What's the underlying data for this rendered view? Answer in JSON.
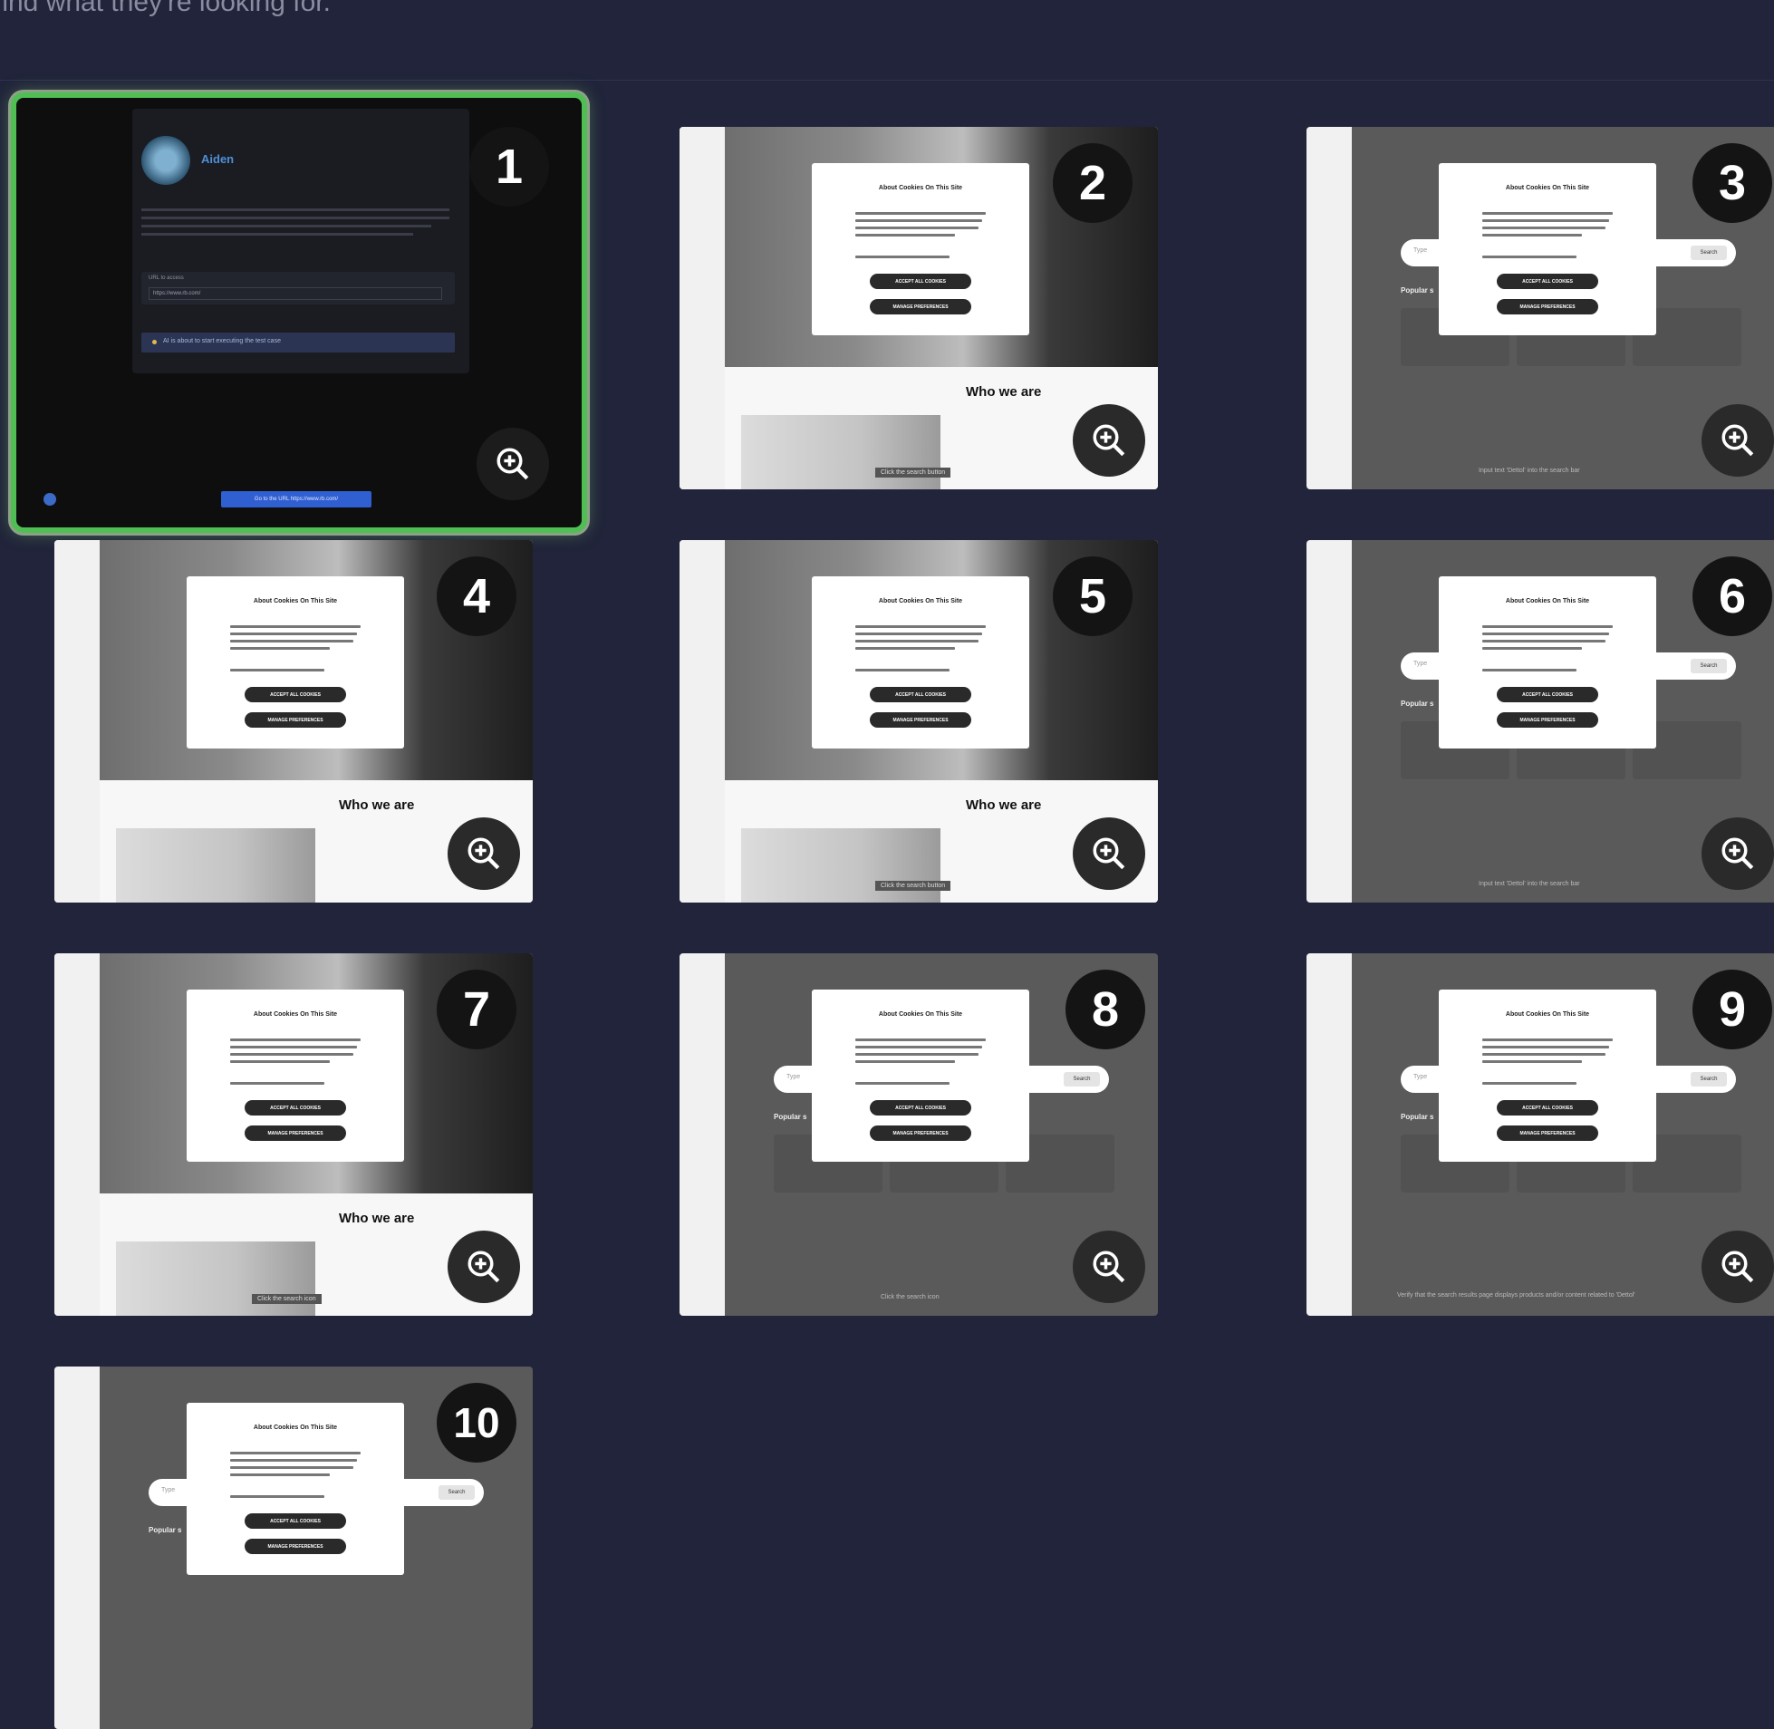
{
  "header": {
    "caption": "find what they're looking for."
  },
  "thumbnails": [
    {
      "number": "1",
      "selected": true,
      "kind": "agent",
      "agent_name": "Aiden",
      "url_label": "URL to access",
      "url_value": "https://www.rb.com/",
      "status_text": "AI is about to start executing the test case",
      "action_text": "Go to the URL https://www.rb.com/"
    },
    {
      "number": "2",
      "kind": "hero",
      "who_title": "Who we are",
      "caption": "Click the search button"
    },
    {
      "number": "3",
      "kind": "search",
      "caption": "Input text 'Dettol' into the search bar"
    },
    {
      "number": "4",
      "kind": "hero",
      "who_title": "Who we are",
      "caption": ""
    },
    {
      "number": "5",
      "kind": "hero",
      "who_title": "Who we are",
      "caption": "Click the search button"
    },
    {
      "number": "6",
      "kind": "search",
      "caption": "Input text 'Dettol' into the search bar"
    },
    {
      "number": "7",
      "kind": "hero",
      "who_title": "Who we are",
      "caption": "Click the search icon"
    },
    {
      "number": "8",
      "kind": "search",
      "caption": "Click the search icon"
    },
    {
      "number": "9",
      "kind": "search",
      "caption": "Verify that the search results page displays products and/or content related to 'Dettol'"
    },
    {
      "number": "10",
      "kind": "search",
      "caption": ""
    }
  ],
  "modal": {
    "title": "About Cookies On This Site",
    "accept_label": "ACCEPT ALL COOKIES",
    "manage_label": "MANAGE PREFERENCES"
  },
  "search": {
    "placeholder": "Type",
    "button_label": "Search",
    "popular_label": "Popular s"
  },
  "icons": {
    "zoom": "zoom-in-icon"
  }
}
